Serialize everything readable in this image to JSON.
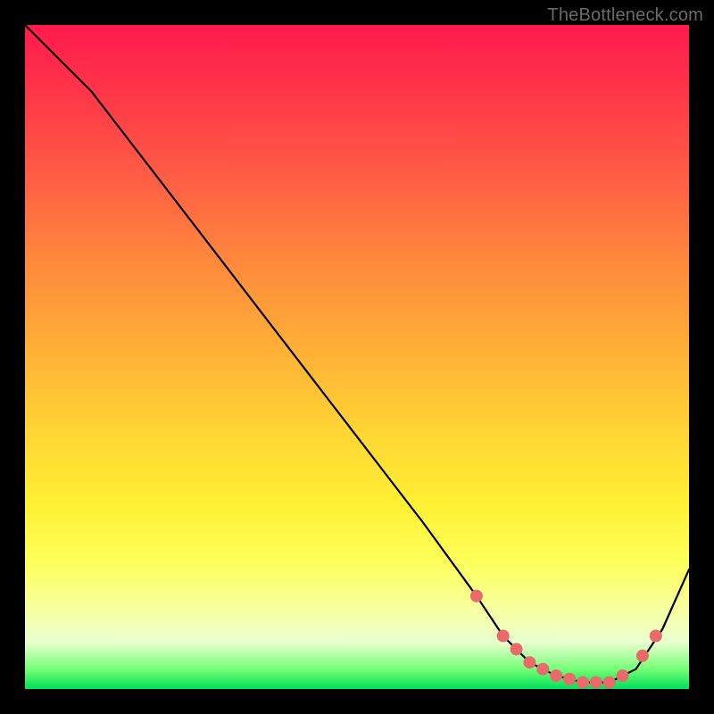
{
  "watermark": "TheBottleneck.com",
  "colors": {
    "dot": "#e96a6a",
    "line": "#000000",
    "frame": "#000000"
  },
  "chart_data": {
    "type": "line",
    "title": "",
    "xlabel": "",
    "ylabel": "",
    "xlim": [
      0,
      100
    ],
    "ylim": [
      0,
      100
    ],
    "grid": false,
    "legend": false,
    "series": [
      {
        "name": "bottleneck-curve",
        "x": [
          0,
          6,
          10,
          20,
          30,
          40,
          50,
          60,
          68,
          72,
          76,
          80,
          84,
          88,
          92,
          96,
          100
        ],
        "y": [
          100,
          94,
          90,
          77,
          64,
          51,
          38,
          25,
          14,
          8,
          4,
          2,
          1,
          1,
          3,
          9,
          18
        ]
      }
    ],
    "markers": {
      "name": "highlighted-points",
      "x": [
        68,
        72,
        74,
        76,
        78,
        80,
        82,
        84,
        86,
        88,
        90,
        93,
        95
      ],
      "y": [
        14,
        8,
        6,
        4,
        3,
        2,
        1.5,
        1,
        1,
        1,
        2,
        5,
        8
      ]
    }
  }
}
